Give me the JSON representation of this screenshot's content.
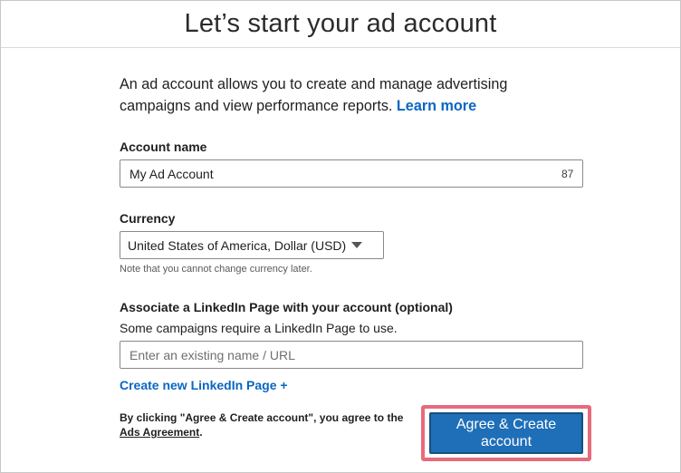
{
  "header": {
    "title": "Let’s start your ad account"
  },
  "intro": {
    "text": "An ad account allows you to create and manage advertising campaigns and view performance reports. ",
    "learn_more": "Learn more"
  },
  "account_name": {
    "label": "Account name",
    "value": "My Ad Account",
    "counter": "87"
  },
  "currency": {
    "label": "Currency",
    "selected": "United States of America, Dollar (USD)",
    "note": "Note that you cannot change currency later."
  },
  "linkedin_page": {
    "label": "Associate a LinkedIn Page with your account (optional)",
    "sublabel": "Some campaigns require a LinkedIn Page to use.",
    "placeholder": "Enter an existing name / URL",
    "create_link": "Create new LinkedIn Page +"
  },
  "footer": {
    "agree_text": "By clicking \"Agree & Create account\", you agree to the ",
    "ads_agreement": "Ads Agreement",
    "period": ".",
    "button_label": "Agree & Create account"
  },
  "colors": {
    "link": "#0a66c2",
    "button": "#1f6fb8",
    "highlight": "#e86a7d"
  }
}
